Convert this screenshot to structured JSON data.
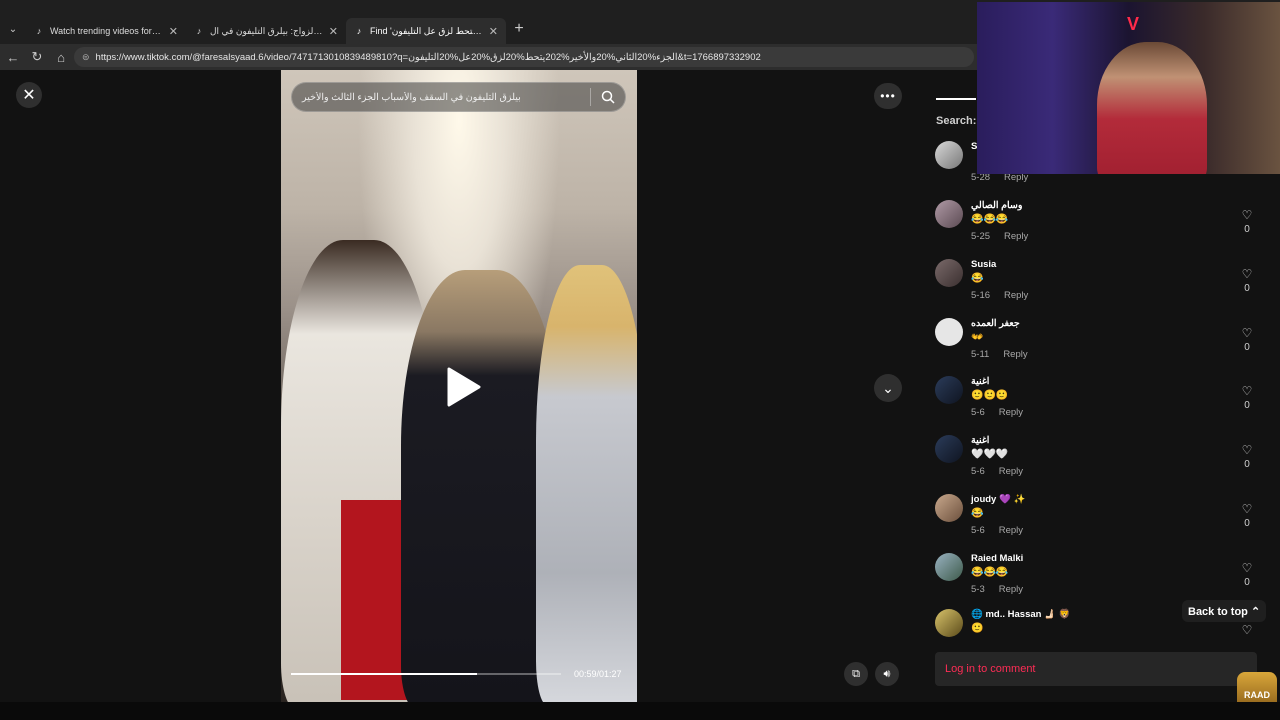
{
  "browser": {
    "tabs": [
      {
        "title": "Watch trending videos for you | Ti",
        "active": false
      },
      {
        "title": "مفاجآت الزواج: بيلرق التليفون في ال...",
        "active": false
      },
      {
        "title": "Find 'والأخير 2يتحط لزق عل التليفون",
        "active": true
      }
    ],
    "url": "https://www.tiktok.com/@faresalsyaad.6/video/7471713010839489810?q=الجزء%20الثاني%20والأخير%202يتحط%20لزق%20عل%20التليفون&t=1766897332902"
  },
  "video": {
    "search_text": "بيلزق التليفون في السقف والأسباب الجزء الثالث والأخير",
    "timecode": "00:59/01:27",
    "progress": 0.69
  },
  "sidebar": {
    "search_label": "Search:",
    "comments": [
      {
        "name": "S",
        "text": "",
        "date": "5-28",
        "reply": "Reply",
        "likes": "0"
      },
      {
        "name": "وسام الصالي",
        "text": "😂😂😂",
        "date": "5-25",
        "reply": "Reply",
        "likes": "0"
      },
      {
        "name": "Susia",
        "text": "😂",
        "date": "5-16",
        "reply": "Reply",
        "likes": "0"
      },
      {
        "name": "جعفر العمده",
        "text": "👐",
        "date": "5-11",
        "reply": "Reply",
        "likes": "0"
      },
      {
        "name": "اغنية",
        "text": "🙂🙂🙂",
        "date": "5-6",
        "reply": "Reply",
        "likes": "0"
      },
      {
        "name": "اغنية",
        "text": "🤍🤍🤍",
        "date": "5-6",
        "reply": "Reply",
        "likes": "0"
      },
      {
        "name": "joudy 💜 ✨",
        "text": "😂",
        "date": "5-6",
        "reply": "Reply",
        "likes": "0"
      },
      {
        "name": "Raied Malki",
        "text": "😂😂😂",
        "date": "5-3",
        "reply": "Reply",
        "likes": "0"
      },
      {
        "name": "🌐 md.. Hassan 🫸🏻 🦁",
        "text": "🙂",
        "date": "",
        "reply": "",
        "likes": ""
      }
    ],
    "back_to_top": "Back to top ⌃",
    "login_prompt": "Log in to comment"
  },
  "overlay": {
    "raad_logo": "RAAD"
  }
}
